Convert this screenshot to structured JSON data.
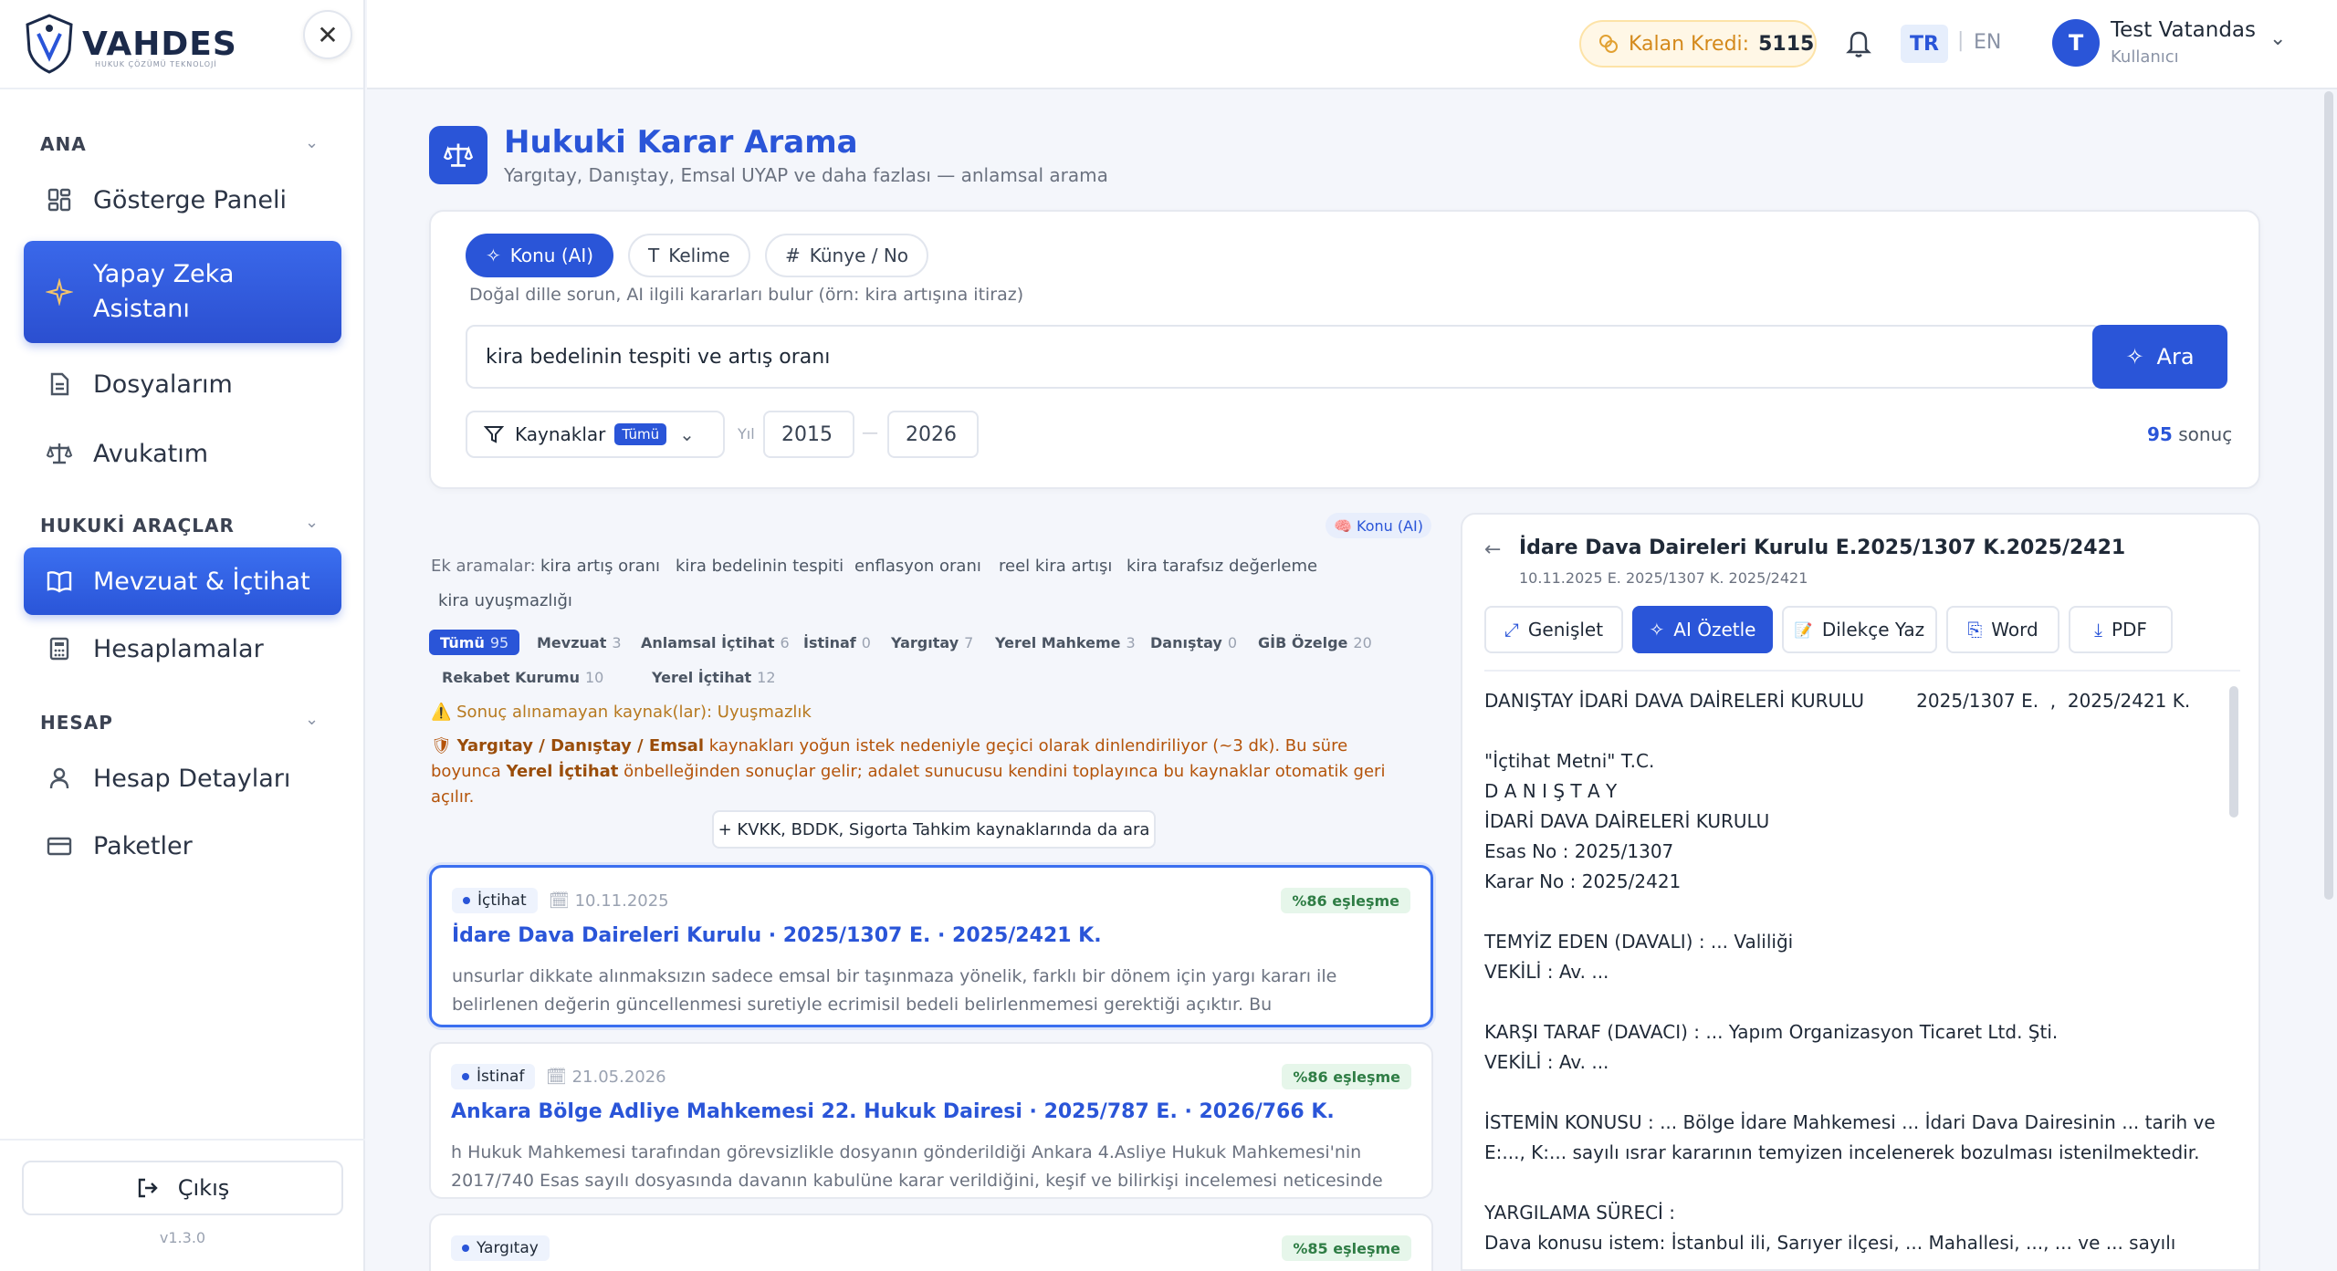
{
  "app": {
    "logo_text": "VAHDES",
    "logo_tagline": "HUKUK ÇÖZÜMÜ TEKNOLOJİ",
    "version": "v1.3.0"
  },
  "sidebar": {
    "sections": [
      {
        "label": "ANA"
      },
      {
        "label": "HUKUKİ ARAÇLAR"
      },
      {
        "label": "HESAP"
      }
    ],
    "items": [
      {
        "label": "Gösterge Paneli",
        "icon": "dashboard-icon"
      },
      {
        "label": "Yapay Zeka Asistanı",
        "icon": "sparkle-icon"
      },
      {
        "label": "Dosyalarım",
        "icon": "file-icon"
      },
      {
        "label": "Avukatım",
        "icon": "scale-icon"
      },
      {
        "label": "Mevzuat & İçtihat",
        "icon": "book-icon",
        "active": true
      },
      {
        "label": "Hesaplamalar",
        "icon": "calculator-icon"
      },
      {
        "label": "Hesap Detayları",
        "icon": "user-icon"
      },
      {
        "label": "Paketler",
        "icon": "card-icon"
      }
    ],
    "logout_label": "Çıkış"
  },
  "topbar": {
    "credit_label": "Kalan Kredi:",
    "credit_value": "5115",
    "lang_active": "TR",
    "lang_other": "EN",
    "user_initial": "T",
    "user_name": "Test Vatandas",
    "user_role": "Kullanıcı"
  },
  "page": {
    "title": "Hukuki Karar Arama",
    "subtitle": "Yargıtay, Danıştay, Emsal UYAP ve daha fazlası — anlamsal arama"
  },
  "search": {
    "modes": [
      {
        "label": "Konu (AI)",
        "active": true
      },
      {
        "label": "Kelime"
      },
      {
        "label": "Künye / No"
      }
    ],
    "hint": "Doğal dille sorun, AI ilgili kararları bulur (örn: kira artışına itiraz)",
    "query": "kira bedelinin tespiti ve artış oranı",
    "button_label": "Ara",
    "sources_label": "Kaynaklar",
    "sources_badge": "Tümü",
    "year_label": "Yıl",
    "year_from": "2015",
    "year_to": "2026",
    "result_count": "95",
    "result_suffix": "sonuç"
  },
  "results_panel": {
    "ai_pill": "🧠 Konu (AI)",
    "extra_label": "Ek aramalar:",
    "extra_terms": [
      "kira artış oranı",
      "kira bedelinin tespiti",
      "enflasyon oranı",
      "reel kira artışı",
      "kira tarafsız değerleme",
      "kira uyuşmazlığı"
    ],
    "filters": [
      {
        "label": "Tümü",
        "count": "95",
        "active": true
      },
      {
        "label": "Mevzuat",
        "count": "3"
      },
      {
        "label": "Anlamsal İçtihat",
        "count": "6"
      },
      {
        "label": "İstinaf",
        "count": "0"
      },
      {
        "label": "Yargıtay",
        "count": "7"
      },
      {
        "label": "Yerel Mahkeme",
        "count": "3"
      },
      {
        "label": "Danıştay",
        "count": "0"
      },
      {
        "label": "GİB Özelge",
        "count": "20"
      },
      {
        "label": "Rekabet Kurumu",
        "count": "10"
      },
      {
        "label": "Yerel İçtihat",
        "count": "12"
      }
    ],
    "warning_unreachable": "⚠️ Sonuç alınamayan kaynak(lar): Uyuşmazlık",
    "warning_throttle_bold1": "Yargıtay / Danıştay / Emsal",
    "warning_throttle_text1": " kaynakları yoğun istek nedeniyle geçici olarak dinlendiriliyor (~3 dk). Bu süre boyunca ",
    "warning_throttle_bold2": "Yerel İçtihat",
    "warning_throttle_text2": " önbelleğinden sonuçlar gelir; adalet sunucusu kendini toplayınca bu kaynaklar otomatik geri açılır.",
    "extra_sources_button": "+ KVKK, BDDK, Sigorta Tahkim kaynaklarında da ara",
    "results": [
      {
        "type": "İçtihat",
        "date": "10.11.2025",
        "match": "%86 eşleşme",
        "title": "İdare Dava Daireleri Kurulu · 2025/1307 E. · 2025/2421 K.",
        "body": "unsurlar dikkate alınmaksızın sadece emsal bir taşınmaza yönelik, farklı bir dönem için yargı kararı ile belirlenen değerin güncellenmesi suretiyle ecrimisil bedeli belirlenmemesi gerektiği açıktır. Bu değerlendirmeler ışığında,..."
      },
      {
        "type": "İstinaf",
        "date": "21.05.2026",
        "match": "%86 eşleşme",
        "title": "Ankara Bölge Adliye Mahkemesi 22. Hukuk Dairesi · 2025/787 E. · 2026/766 K.",
        "body": "h Hukuk Mahkemesi tarafından görevsizlikle dosyanın gönderildiği Ankara 4.Asliye Hukuk Mahkemesi'nin 2017/740 Esas sayılı dosyasında davanın kabulüne karar verildiğini, keşif ve bilirkişi incelemesi neticesinde aylık..."
      },
      {
        "type": "Yargıtay",
        "date": "",
        "match": "%85 eşleşme",
        "title": "",
        "body": ""
      }
    ]
  },
  "detail": {
    "title": "İdare Dava Daireleri Kurulu E.2025/1307 K.2025/2421",
    "meta": "10.11.2025   E. 2025/1307   K. 2025/2421",
    "buttons": [
      {
        "label": "Genişlet",
        "icon": "expand-icon"
      },
      {
        "label": "AI Özetle",
        "icon": "sparkle-icon",
        "primary": true
      },
      {
        "label": "Dilekçe Yaz",
        "icon": "memo-icon"
      },
      {
        "label": "Word",
        "icon": "word-icon"
      },
      {
        "label": "PDF",
        "icon": "download-icon"
      }
    ],
    "text": "DANIŞTAY İDARİ DAVA DAİRELERİ KURULU         2025/1307 E.  ,  2025/2421 K.\n\n\"İçtihat Metni\" T.C.\nD A N I Ş T A Y\nİDARİ DAVA DAİRELERİ KURULU\nEsas No : 2025/1307\nKarar No : 2025/2421\n\nTEMYİZ EDEN (DAVALI) : ... Valiliği\nVEKİLİ : Av. ...\n\nKARŞI TARAF (DAVACI) : ... Yapım Organizasyon Ticaret Ltd. Şti.\nVEKİLİ : Av. ...\n\nİSTEMİN KONUSU : ... Bölge İdare Mahkemesi ... İdari Dava Dairesinin ... tarih ve E:..., K:... sayılı ısrar kararının temyizen incelenerek bozulması istenilmektedir.\n\nYARGILAMA SÜRECİ :\nDava konusu istem: İstanbul ili, Sarıyer ilçesi, ... Mahallesi, ..., ... ve ... sayılı"
  },
  "colors": {
    "accent": "#2a55d8",
    "match_green": "#2f7d45",
    "warning": "#b45309"
  }
}
